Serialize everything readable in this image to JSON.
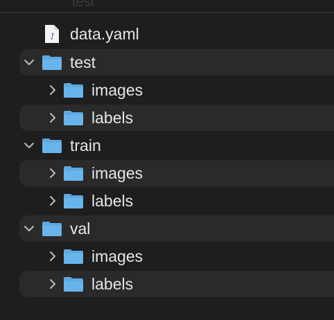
{
  "top_label": "test",
  "tree": {
    "file": {
      "name": "data.yaml",
      "icon": "yaml-file-icon"
    },
    "folders": [
      {
        "name": "test",
        "expanded": true,
        "children": [
          {
            "name": "images",
            "expanded": false
          },
          {
            "name": "labels",
            "expanded": false
          }
        ]
      },
      {
        "name": "train",
        "expanded": true,
        "children": [
          {
            "name": "images",
            "expanded": false
          },
          {
            "name": "labels",
            "expanded": false
          }
        ]
      },
      {
        "name": "val",
        "expanded": true,
        "children": [
          {
            "name": "images",
            "expanded": false
          },
          {
            "name": "labels",
            "expanded": false
          }
        ]
      }
    ]
  },
  "colors": {
    "background": "#1e1e1e",
    "stripe": "#2a2a2a",
    "folder": "#5fa8e0",
    "text": "#e6e6e6",
    "chevron": "#bdbdbd"
  }
}
